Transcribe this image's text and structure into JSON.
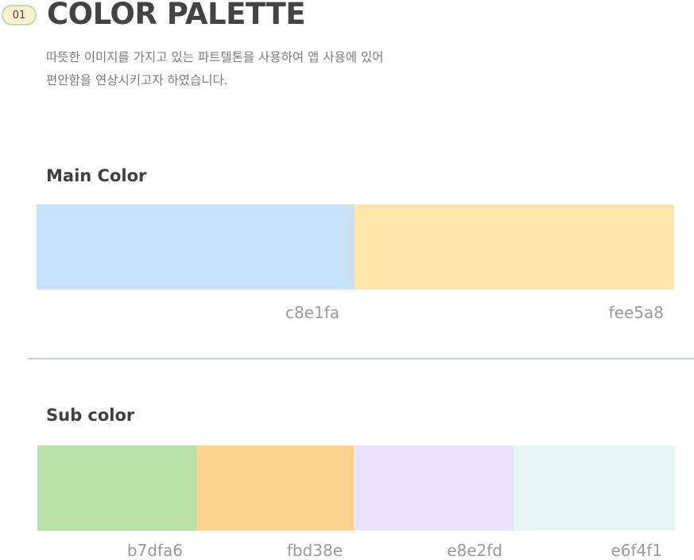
{
  "header": {
    "badge": "01",
    "title": "COLOR PALETTE",
    "description_line1": "따뜻한 이미지를 가지고 있는 파트텔톤을 사용하여 앱 사용에 있어",
    "description_line2": "편안함을 연상시키고자 하였습니다."
  },
  "main_color": {
    "title": "Main Color",
    "swatches": [
      {
        "hex": "c8e1fa",
        "color": "#c8e1fa"
      },
      {
        "hex": "fee5a8",
        "color": "#fee5a8"
      }
    ]
  },
  "sub_color": {
    "title": "Sub color",
    "swatches": [
      {
        "hex": "b7dfa6",
        "color": "#b7dfa6"
      },
      {
        "hex": "fbd38e",
        "color": "#fbd38e"
      },
      {
        "hex": "e8e2fd",
        "color": "#e8e2fd"
      },
      {
        "hex": "e6f4f1",
        "color": "#e6f4f1"
      }
    ]
  }
}
